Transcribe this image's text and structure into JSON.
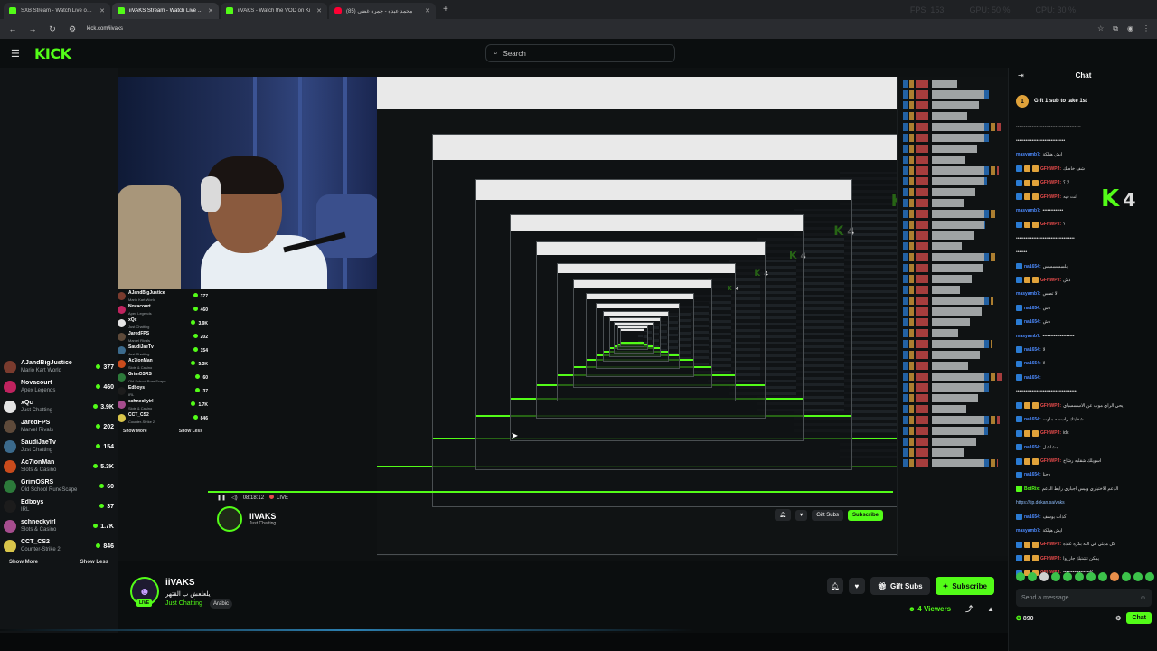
{
  "browser": {
    "tabs": [
      {
        "label": "SXB Stream - Watch Live on Ki",
        "fav": "kick",
        "active": false
      },
      {
        "label": "iiVAKS Stream - Watch Live on",
        "fav": "kick",
        "active": true
      },
      {
        "label": "iiVAKS - Watch the VOD on Ki",
        "fav": "kick",
        "active": false
      },
      {
        "label": "(85) محمد عبده - جمرة غضى",
        "fav": "youtube",
        "active": false
      }
    ],
    "url": "kick.com/iivaks",
    "overlay_stats": [
      "FPS: 153",
      "GPU: 50 %",
      "CPU: 30 %"
    ]
  },
  "header": {
    "logo": "KICK",
    "search_placeholder": "Search"
  },
  "sidebar": {
    "channels": [
      {
        "name": "AJandBigJustice",
        "game": "Mario Kart World",
        "viewers": "377",
        "color": "#7a3b2e"
      },
      {
        "name": "Novacourt",
        "game": "Apex Legends",
        "viewers": "460",
        "color": "#c0235f"
      },
      {
        "name": "xQc",
        "game": "Just Chatting",
        "viewers": "3.9K",
        "color": "#e5e5e5"
      },
      {
        "name": "JaredFPS",
        "game": "Marvel Rivals",
        "viewers": "202",
        "color": "#5e4a3a"
      },
      {
        "name": "SaudiJaeTv",
        "game": "Just Chatting",
        "viewers": "154",
        "color": "#3b6a8c"
      },
      {
        "name": "Ac7ionMan",
        "game": "Slots & Casino",
        "viewers": "5.3K",
        "color": "#c94b1c"
      },
      {
        "name": "GrimOSRS",
        "game": "Old School RuneScape",
        "viewers": "60",
        "color": "#2c7a3a"
      },
      {
        "name": "Edboys",
        "game": "IRL",
        "viewers": "37",
        "color": "#1c1c1c"
      },
      {
        "name": "schneckyirl",
        "game": "Slots & Casino",
        "viewers": "1.7K",
        "color": "#a64d8e"
      },
      {
        "name": "CCT_CS2",
        "game": "Counter-Strike 2",
        "viewers": "846",
        "color": "#d9c54a"
      }
    ],
    "show_more": "Show More",
    "show_less": "Show Less"
  },
  "stream": {
    "inner_time": "08:18:12",
    "inner_live": "LIVE",
    "inner_gift": "Gift Subs",
    "inner_subscribe": "Subscribe",
    "k4_label": "4"
  },
  "info": {
    "streamer": "iiVAKS",
    "title": "يلعلعش ب القتهر",
    "category": "Just Chatting",
    "tag": "Arabic",
    "live": "LIVE",
    "gift_subs": "Gift Subs",
    "subscribe": "Subscribe",
    "viewers": "4 Viewers"
  },
  "chat": {
    "title": "Chat",
    "pinned": "Gift 1 sub to take 1st",
    "messages": [
      {
        "user": "",
        "text": "•••••••••••••••••••••••••••••••••••••••••",
        "color": "#ddd",
        "badges": []
      },
      {
        "user": "",
        "text": "•••••••••••••••••••••••••••••••",
        "color": "#ddd",
        "badges": []
      },
      {
        "user": "masyamb7:",
        "text": "ايش هيلكة",
        "color": "#4d8bff",
        "badges": []
      },
      {
        "user": "GFHWPJ:",
        "text": "شف خاصك",
        "color": "#e84b4b",
        "badges": [
          "#2a7bd3",
          "#e0a23a",
          "#e0a23a"
        ]
      },
      {
        "user": "GFHWPJ:",
        "text": "لا ؟",
        "color": "#e84b4b",
        "badges": [
          "#2a7bd3",
          "#e0a23a",
          "#e0a23a"
        ]
      },
      {
        "user": "GFHWPJ:",
        "text": "انت فيه",
        "color": "#e84b4b",
        "badges": [
          "#2a7bd3",
          "#e0a23a",
          "#e0a23a"
        ]
      },
      {
        "user": "masyamb7:",
        "text": "•••••••••••••",
        "color": "#4d8bff",
        "badges": []
      },
      {
        "user": "GFHWPJ:",
        "text": "؟",
        "color": "#e84b4b",
        "badges": [
          "#2a7bd3",
          "#e0a23a",
          "#e0a23a"
        ]
      },
      {
        "user": "",
        "text": "•••••••••••••••••••••••••••••••••••••",
        "color": "#ddd",
        "badges": []
      },
      {
        "user": "",
        "text": "•••••••",
        "color": "#ddd",
        "badges": []
      },
      {
        "user": "na1654:",
        "text": "بلسسسسس",
        "color": "#4d8bff",
        "badges": [
          "#2a7bd3"
        ]
      },
      {
        "user": "GFHWPJ:",
        "text": "دش",
        "color": "#e84b4b",
        "badges": [
          "#2a7bd3",
          "#e0a23a",
          "#e0a23a"
        ]
      },
      {
        "user": "masyamb7:",
        "text": "لا تطس",
        "color": "#4d8bff",
        "badges": []
      },
      {
        "user": "na1654:",
        "text": "دش",
        "color": "#4d8bff",
        "badges": [
          "#2a7bd3"
        ]
      },
      {
        "user": "na1654:",
        "text": "دش",
        "color": "#4d8bff",
        "badges": [
          "#2a7bd3"
        ]
      },
      {
        "user": "masyamb7:",
        "text": "••••••••••••••••••••",
        "color": "#4d8bff",
        "badges": []
      },
      {
        "user": "na1654:",
        "text": "لا",
        "color": "#4d8bff",
        "badges": [
          "#2a7bd3"
        ]
      },
      {
        "user": "na1654:",
        "text": "لا",
        "color": "#4d8bff",
        "badges": [
          "#2a7bd3"
        ]
      },
      {
        "user": "na1654:",
        "text": "",
        "color": "#4d8bff",
        "badges": [
          "#2a7bd3"
        ]
      },
      {
        "user": "",
        "text": "•••••••••••••••••••••••••••••••••••••••",
        "color": "#ddd",
        "badges": []
      },
      {
        "user": "GFHWPJ:",
        "text": "يحي الراي موب عن الاسسسباي",
        "color": "#e84b4b",
        "badges": [
          "#2a7bd3",
          "#e0a23a",
          "#e0a23a"
        ]
      },
      {
        "user": "na1654:",
        "text": "شفايتك راسسه ملوت",
        "color": "#4d8bff",
        "badges": [
          "#2a7bd3"
        ]
      },
      {
        "user": "GFHWPJ:",
        "text": "idc",
        "color": "#e84b4b",
        "badges": [
          "#2a7bd3",
          "#e0a23a",
          "#e0a23a"
        ]
      },
      {
        "user": "na1654:",
        "text": "مشلشل",
        "color": "#4d8bff",
        "badges": [
          "#2a7bd3"
        ]
      },
      {
        "user": "GFHWPJ:",
        "text": "اسويلك شقلبه رشاح",
        "color": "#e84b4b",
        "badges": [
          "#2a7bd3",
          "#e0a23a",
          "#e0a23a"
        ]
      },
      {
        "user": "na1654:",
        "text": "دحنا",
        "color": "#4d8bff",
        "badges": [
          "#2a7bd3"
        ]
      },
      {
        "user": "BotRix:",
        "text": "الدعم الاختياري وليس اجباري رابط الدعم",
        "color": "#53fc18",
        "badges": [
          "#53fc18"
        ]
      },
      {
        "user": "",
        "text": "https://tip.dokan.sa/vaks",
        "color": "#8fbfff",
        "badges": []
      },
      {
        "user": "na1654:",
        "text": "كذاب يوسف",
        "color": "#4d8bff",
        "badges": [
          "#2a7bd3"
        ]
      },
      {
        "user": "masyamb7:",
        "text": "ايش هيلكة",
        "color": "#4d8bff",
        "badges": []
      },
      {
        "user": "GFHWPJ:",
        "text": "كل مابتي في الله بكره عنده",
        "color": "#e84b4b",
        "badges": [
          "#2a7bd3",
          "#e0a23a",
          "#e0a23a"
        ]
      },
      {
        "user": "GFHWPJ:",
        "text": "يمكن تشتبك جارزوا",
        "color": "#e84b4b",
        "badges": [
          "#2a7bd3",
          "#e0a23a",
          "#e0a23a"
        ]
      },
      {
        "user": "GFHWPJ:",
        "text": "•••••••••••••••••K",
        "color": "#e84b4b",
        "badges": [
          "#2a7bd3",
          "#e0a23a",
          "#e0a23a"
        ]
      }
    ],
    "k4": "4",
    "input_placeholder": "Send a message",
    "points": "890",
    "send": "Chat"
  }
}
